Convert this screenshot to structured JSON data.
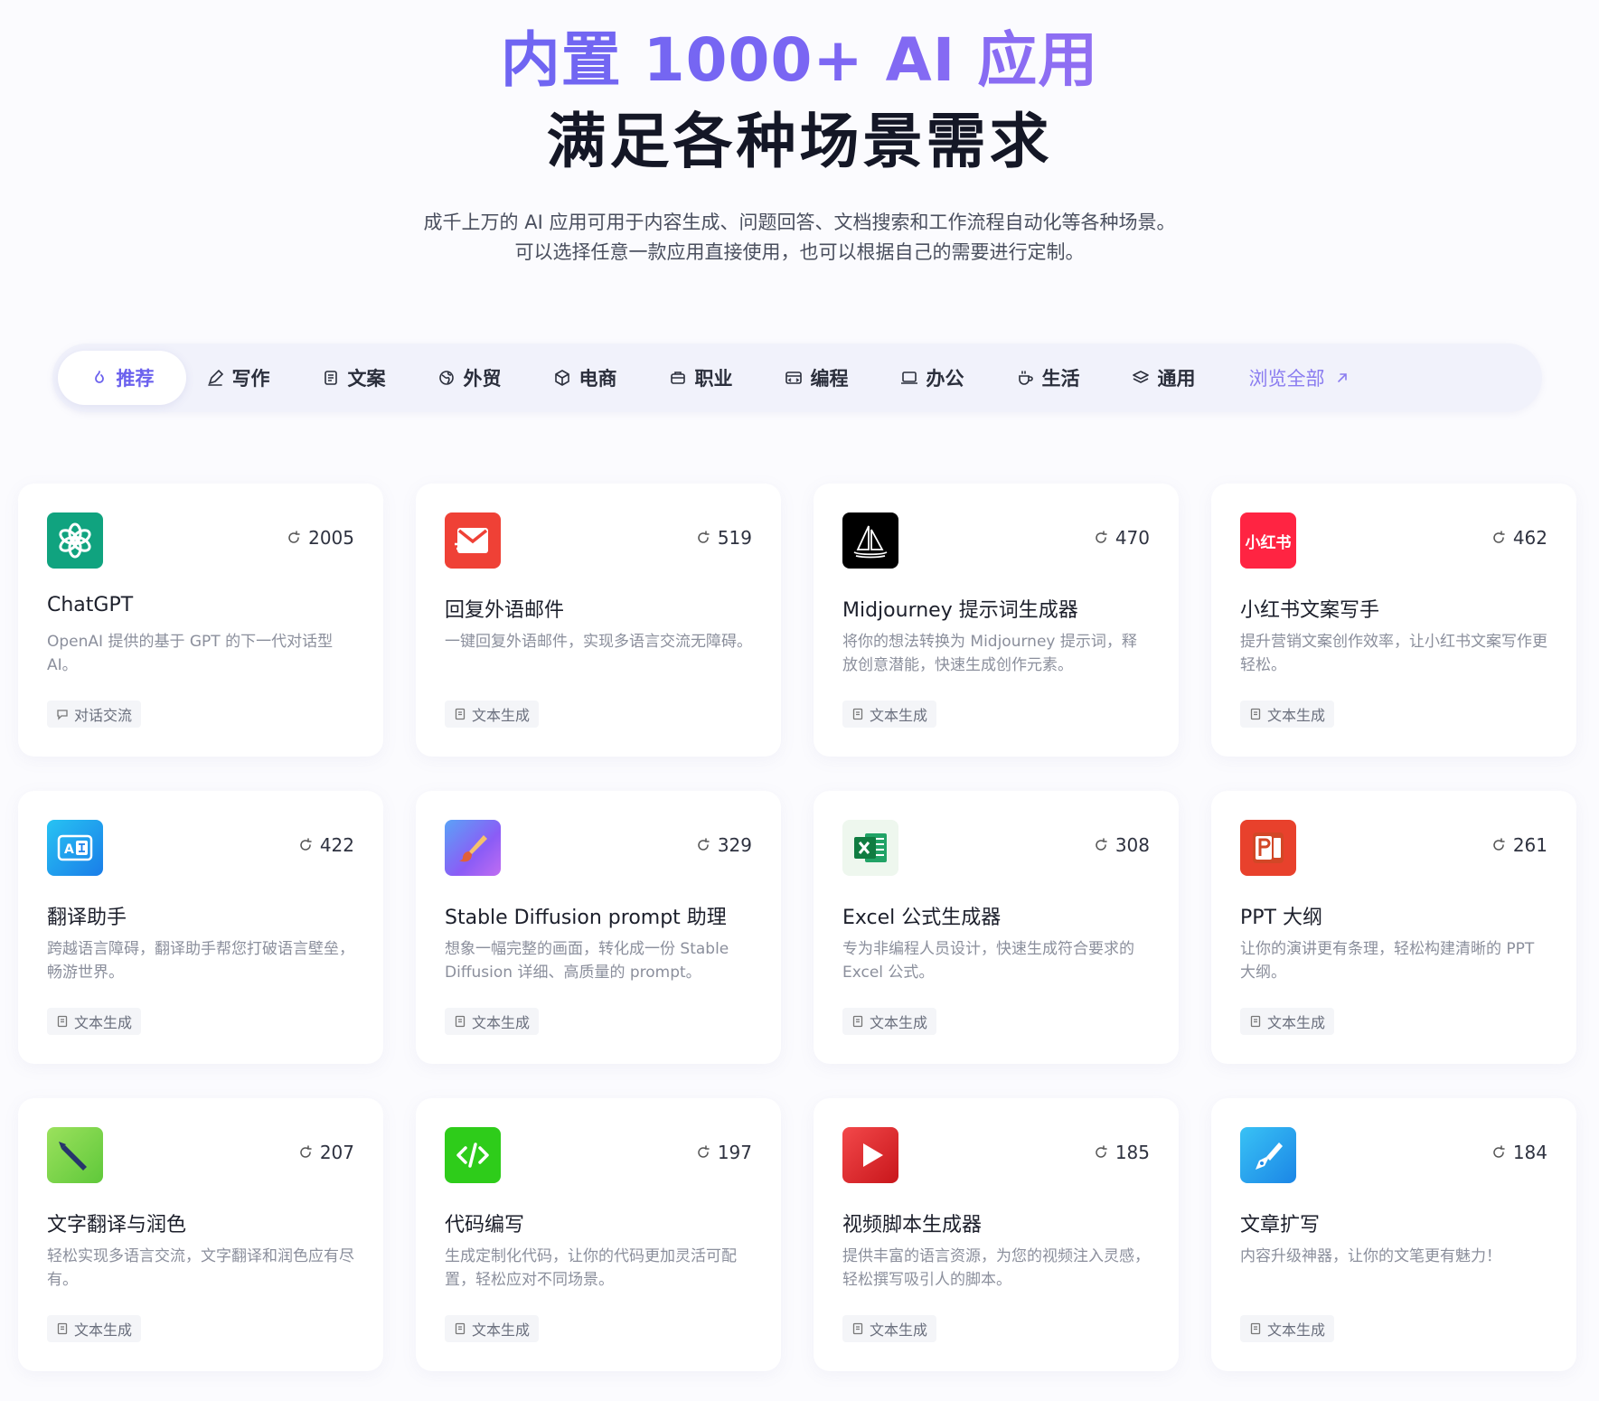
{
  "hero": {
    "title": "内置 1000+ AI 应用",
    "subtitle": "满足各种场景需求",
    "desc_line1": "成千上万的 AI 应用可用于内容生成、问题回答、文档搜索和工作流程自动化等各种场景。",
    "desc_line2": "可以选择任意一款应用直接使用，也可以根据自己的需要进行定制。"
  },
  "tabs": [
    {
      "label": "推荐",
      "icon": "flame-icon",
      "active": true
    },
    {
      "label": "写作",
      "icon": "pen-icon"
    },
    {
      "label": "文案",
      "icon": "document-icon"
    },
    {
      "label": "外贸",
      "icon": "globe-icon"
    },
    {
      "label": "电商",
      "icon": "package-icon"
    },
    {
      "label": "职业",
      "icon": "briefcase-icon"
    },
    {
      "label": "编程",
      "icon": "code-window-icon"
    },
    {
      "label": "办公",
      "icon": "laptop-icon"
    },
    {
      "label": "生活",
      "icon": "cup-icon"
    },
    {
      "label": "通用",
      "icon": "layers-icon"
    }
  ],
  "browse_all": {
    "label": "浏览全部",
    "icon": "arrow-up-right-icon"
  },
  "colors": {
    "accent": "#6b61ee",
    "text_muted": "#8b8f9c"
  },
  "apps": [
    {
      "name": "ChatGPT",
      "desc": "OpenAI 提供的基于 GPT 的下一代对话型 AI。",
      "uses": "2005",
      "tag": "对话交流",
      "tag_icon": "chat-icon",
      "icon": "openai-icon",
      "color": "#10a37f"
    },
    {
      "name": "回复外语邮件",
      "desc": "一键回复外语邮件，实现多语言交流无障碍。",
      "uses": "519",
      "tag": "文本生成",
      "tag_icon": "document-icon",
      "icon": "mail-icon",
      "color": "#ef4136"
    },
    {
      "name": "Midjourney 提示词生成器",
      "desc": "将你的想法转换为 Midjourney 提示词，释放创意潜能，快速生成创作元素。",
      "uses": "470",
      "tag": "文本生成",
      "tag_icon": "document-icon",
      "icon": "sailboat-icon",
      "color": "#000000"
    },
    {
      "name": "小红书文案写手",
      "desc": "提升营销文案创作效率，让小红书文案写作更轻松。",
      "uses": "462",
      "tag": "文本生成",
      "tag_icon": "document-icon",
      "icon": "xiaohongshu-logo",
      "logo_text": "小红书",
      "color": "#ff2442"
    },
    {
      "name": "翻译助手",
      "desc": "跨越语言障碍，翻译助手帮您打破语言壁垒，畅游世界。",
      "uses": "422",
      "tag": "文本生成",
      "tag_icon": "document-icon",
      "icon": "translate-icon",
      "color": "#1e9bf0"
    },
    {
      "name": "Stable Diffusion prompt 助理",
      "desc": "想象一幅完整的画面，转化成一份 Stable Diffusion 详细、高质量的 prompt。",
      "uses": "329",
      "tag": "文本生成",
      "tag_icon": "document-icon",
      "icon": "paintbrush-icon",
      "color": "#7b6cf6"
    },
    {
      "name": "Excel 公式生成器",
      "desc": "专为非编程人员设计，快速生成符合要求的 Excel 公式。",
      "uses": "308",
      "tag": "文本生成",
      "tag_icon": "document-icon",
      "icon": "excel-icon",
      "color": "#1d7044"
    },
    {
      "name": "PPT 大纲",
      "desc": "让你的演讲更有条理，轻松构建清晰的 PPT 大纲。",
      "uses": "261",
      "tag": "文本生成",
      "tag_icon": "document-icon",
      "icon": "powerpoint-icon",
      "color": "#d24726"
    },
    {
      "name": "文字翻译与润色",
      "desc": "轻松实现多语言交流，文字翻译和润色应有尽有。",
      "uses": "207",
      "tag": "文本生成",
      "tag_icon": "document-icon",
      "icon": "pen-nib-icon",
      "color": "#7ed957"
    },
    {
      "name": "代码编写",
      "desc": "生成定制化代码，让你的代码更加灵活可配置，轻松应对不同场景。",
      "uses": "197",
      "tag": "文本生成",
      "tag_icon": "document-icon",
      "icon": "code-icon",
      "color": "#2ecc1a"
    },
    {
      "name": "视频脚本生成器",
      "desc": "提供丰富的语言资源，为您的视频注入灵感，轻松撰写吸引人的脚本。",
      "uses": "185",
      "tag": "文本生成",
      "tag_icon": "document-icon",
      "icon": "play-icon",
      "color": "#e8262b"
    },
    {
      "name": "文章扩写",
      "desc": "内容升级神器，让你的文笔更有魅力！",
      "uses": "184",
      "tag": "文本生成",
      "tag_icon": "document-icon",
      "icon": "fountain-pen-icon",
      "color": "#22a7f0"
    }
  ]
}
